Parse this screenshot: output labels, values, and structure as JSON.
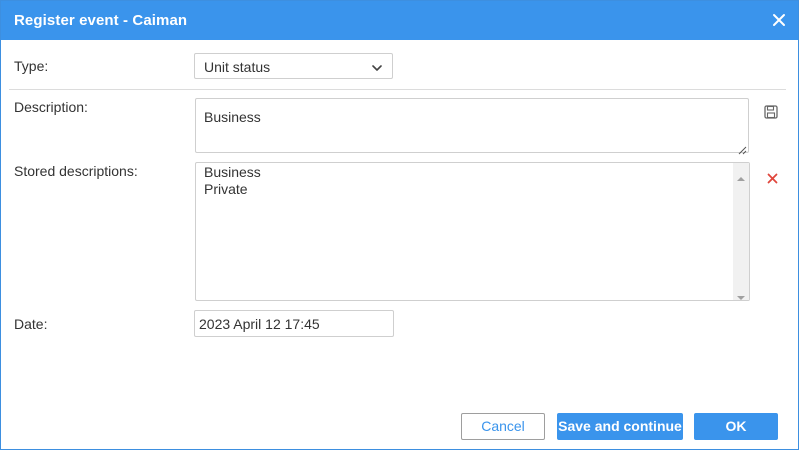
{
  "dialog": {
    "title": "Register event - Caiman",
    "close_icon": "close-icon"
  },
  "form": {
    "type_label": "Type:",
    "type_value": "Unit status",
    "description_label": "Description:",
    "description_value": "Business",
    "stored_label": "Stored descriptions:",
    "stored_items": [
      "Business",
      "Private"
    ],
    "date_label": "Date:",
    "date_value": "2023 April 12 17:45"
  },
  "icons": {
    "save": "save-icon",
    "delete": "delete-icon",
    "dropdown": "chevron-down-icon"
  },
  "buttons": {
    "cancel": "Cancel",
    "save_continue": "Save and continue",
    "ok": "OK"
  },
  "colors": {
    "accent": "#3a94ec",
    "delete": "#e0463c"
  }
}
